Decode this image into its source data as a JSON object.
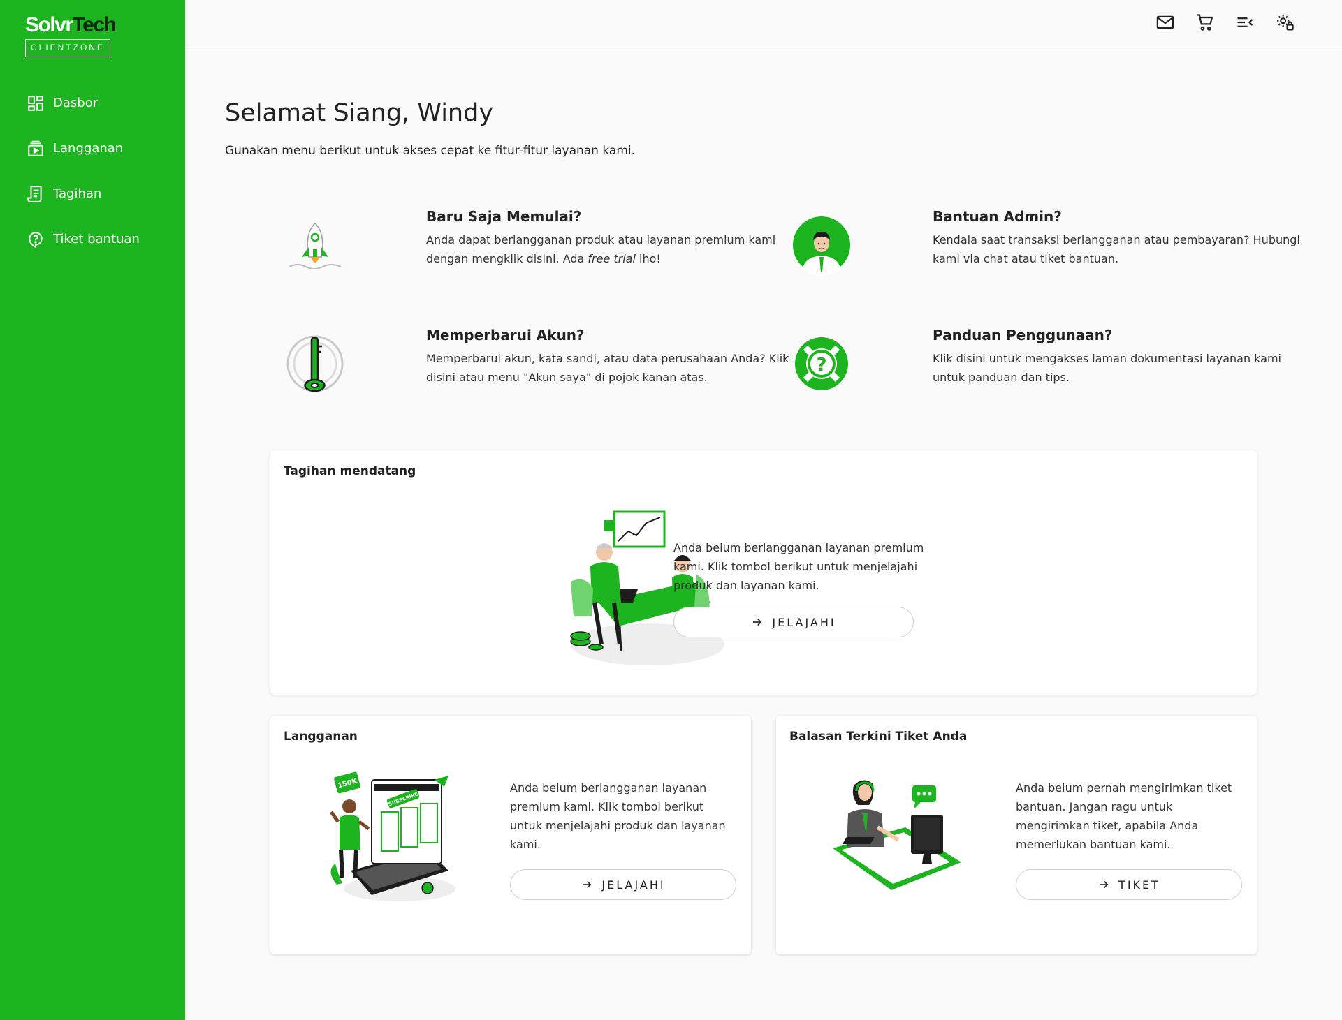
{
  "app": {
    "logo_main": "Solvr",
    "logo_accent": "Tech",
    "logo_sub": "CLIENTZONE"
  },
  "colors": {
    "brand": "#1cb51f",
    "dark": "#0d2a0d"
  },
  "sidebar": {
    "items": [
      {
        "label": "Dasbor",
        "icon": "dashboard-icon"
      },
      {
        "label": "Langganan",
        "icon": "subscriptions-icon"
      },
      {
        "label": "Tagihan",
        "icon": "receipt-icon"
      },
      {
        "label": "Tiket bantuan",
        "icon": "help-ticket-icon"
      }
    ]
  },
  "header": {
    "icons": [
      "mail-icon",
      "cart-icon",
      "menu-collapse-icon",
      "account-settings-icon"
    ]
  },
  "main": {
    "greeting": "Selamat Siang, Windy",
    "subtitle": "Gunakan menu berikut untuk akses cepat ke fitur-fitur layanan kami.",
    "quick": [
      {
        "title": "Baru Saja Memulai?",
        "text_a": "Anda dapat berlangganan produk atau layanan premium kami dengan mengklik disini. Ada ",
        "text_em": "free trial",
        "text_b": " lho!",
        "icon": "rocket-icon"
      },
      {
        "title": "Bantuan Admin?",
        "text": "Kendala saat transaksi berlangganan atau pembayaran? Hubungi kami via chat atau tiket bantuan.",
        "icon": "admin-avatar-icon"
      },
      {
        "title": "Memperbarui Akun?",
        "text": "Memperbarui akun, kata sandi, atau data perusahaan Anda? Klik disini atau menu \"Akun saya\" di pojok kanan atas.",
        "icon": "key-icon"
      },
      {
        "title": "Panduan Penggunaan?",
        "text": "Klik disini untuk mengakses laman dokumentasi layanan kami untuk panduan dan tips.",
        "icon": "lifebuoy-icon"
      }
    ],
    "cards": {
      "billing": {
        "title": "Tagihan mendatang",
        "text": "Anda belum berlangganan layanan premium kami. Klik tombol berikut untuk menjelajahi produk dan layanan kami.",
        "button": "JELAJAHI"
      },
      "subscription": {
        "title": "Langganan",
        "text": "Anda belum berlangganan layanan premium kami. Klik tombol berikut untuk menjelajahi produk dan layanan kami.",
        "button": "JELAJAHI",
        "badge": "150K",
        "tag": "SUBSCRIBE"
      },
      "tickets": {
        "title": "Balasan Terkini Tiket Anda",
        "text": "Anda belum pernah mengirimkan tiket bantuan. Jangan ragu untuk mengirimkan tiket, apabila Anda memerlukan bantuan kami.",
        "button": "TIKET"
      }
    }
  }
}
